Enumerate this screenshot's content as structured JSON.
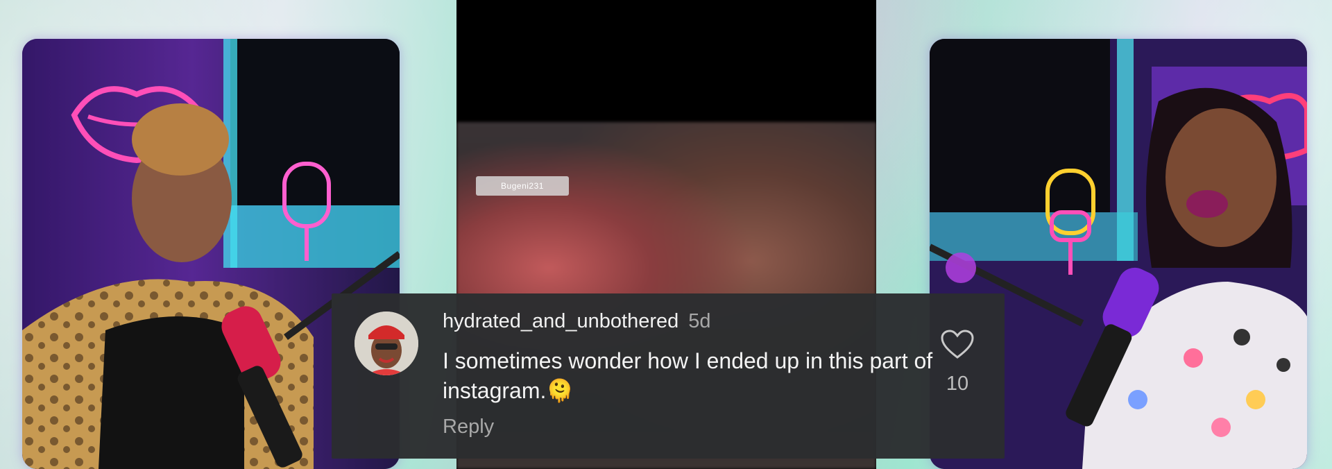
{
  "video": {
    "username_tag": "Bugeni231"
  },
  "comment": {
    "username": "hydrated_and_unbothered",
    "age": "5d",
    "text": "I sometimes wonder how I ended up in this part of instagram.",
    "emoji": "🫠",
    "reply_label": "Reply",
    "like_count": "10",
    "like_icon": "heart-outline-icon"
  },
  "colors": {
    "card_bg": "#2b2d30",
    "text_primary": "#f1f1f1",
    "text_secondary": "#a8a8a8",
    "neon_pink": "#ff3fa6",
    "neon_purple": "#a34cff",
    "neon_cyan": "#3fe0ff"
  }
}
